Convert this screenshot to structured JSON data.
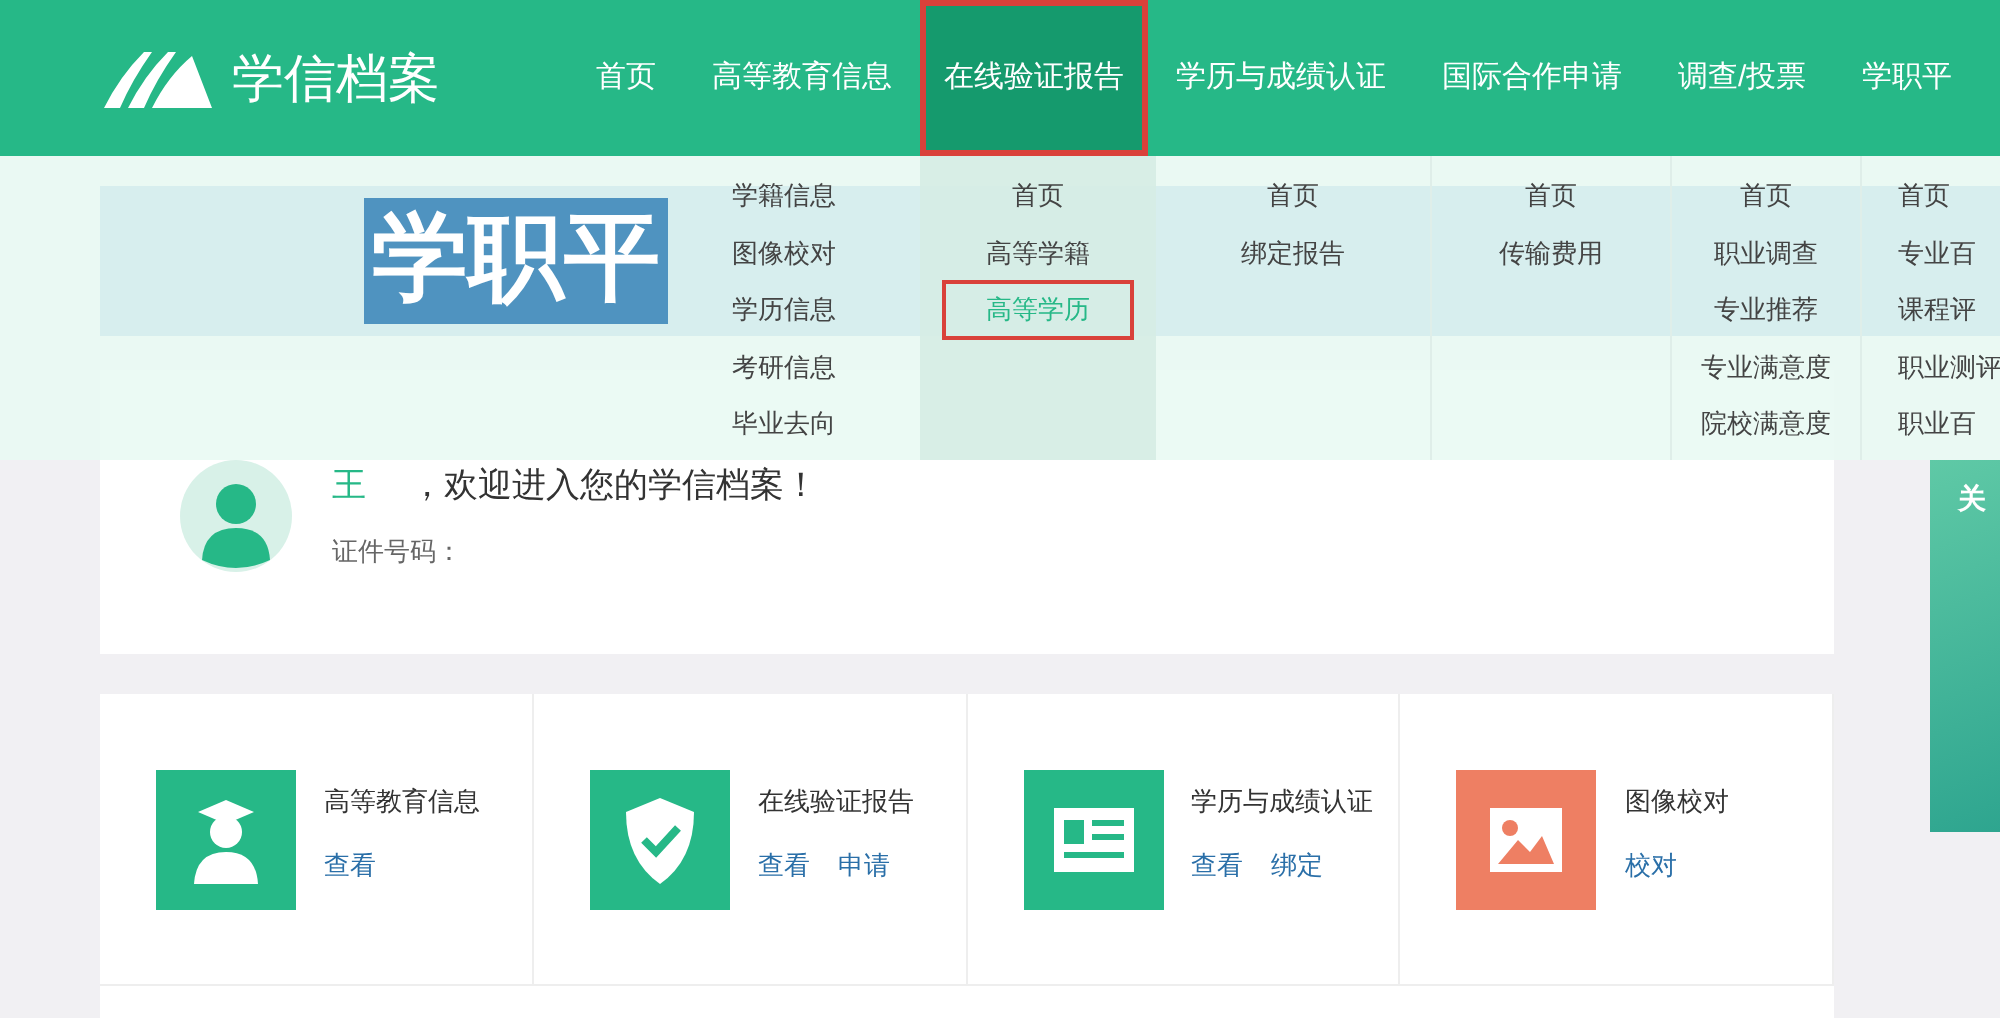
{
  "nav": {
    "logo": "学信档案",
    "items": [
      {
        "label": "首页",
        "selected": false,
        "marked": false
      },
      {
        "label": "高等教育信息",
        "selected": false,
        "marked": false,
        "submenu": [
          {
            "label": "学籍信息",
            "selected": false,
            "marked": false
          },
          {
            "label": "图像校对",
            "selected": false,
            "marked": false
          },
          {
            "label": "学历信息",
            "selected": false,
            "marked": false
          },
          {
            "label": "考研信息",
            "selected": false,
            "marked": false
          },
          {
            "label": "毕业去向",
            "selected": false,
            "marked": false
          }
        ]
      },
      {
        "label": "在线验证报告",
        "selected": true,
        "marked": true,
        "submenu": [
          {
            "label": "首页",
            "selected": false,
            "marked": false
          },
          {
            "label": "高等学籍",
            "selected": false,
            "marked": false
          },
          {
            "label": "高等学历",
            "selected": true,
            "marked": true
          }
        ]
      },
      {
        "label": "学历与成绩认证",
        "selected": false,
        "marked": false,
        "submenu": [
          {
            "label": "首页",
            "selected": false,
            "marked": false
          },
          {
            "label": "绑定报告",
            "selected": false,
            "marked": false
          }
        ]
      },
      {
        "label": "国际合作申请",
        "selected": false,
        "marked": false,
        "submenu": [
          {
            "label": "首页",
            "selected": false,
            "marked": false
          },
          {
            "label": "传输费用",
            "selected": false,
            "marked": false
          }
        ]
      },
      {
        "label": "调查/投票",
        "selected": false,
        "marked": false,
        "submenu": [
          {
            "label": "首页",
            "selected": false,
            "marked": false
          },
          {
            "label": "职业调查",
            "selected": false,
            "marked": false
          },
          {
            "label": "专业推荐",
            "selected": false,
            "marked": false
          },
          {
            "label": "专业满意度",
            "selected": false,
            "marked": false
          },
          {
            "label": "院校满意度",
            "selected": false,
            "marked": false
          }
        ]
      },
      {
        "label": "学职平",
        "selected": false,
        "marked": false,
        "submenu": [
          {
            "label": "首页",
            "selected": false,
            "marked": false
          },
          {
            "label": "专业百",
            "selected": false,
            "marked": false
          },
          {
            "label": "课程评",
            "selected": false,
            "marked": false
          },
          {
            "label": "职业测评",
            "selected": false,
            "marked": false
          },
          {
            "label": "职业百",
            "selected": false,
            "marked": false
          }
        ]
      }
    ]
  },
  "banner": {
    "text": "学职平"
  },
  "welcome": {
    "name": "王",
    "greeting": "，欢迎进入您的学信档案！",
    "id_label": "证件号码："
  },
  "side_ad": {
    "text": "关"
  },
  "services": [
    {
      "title": "高等教育信息",
      "kind": "graduate",
      "color": "#26b887",
      "links": [
        "查看"
      ]
    },
    {
      "title": "在线验证报告",
      "kind": "shield",
      "color": "#26b887",
      "links": [
        "查看",
        "申请"
      ]
    },
    {
      "title": "学历与成绩认证",
      "kind": "document",
      "color": "#26b887",
      "links": [
        "查看",
        "绑定"
      ]
    },
    {
      "title": "图像校对",
      "kind": "image",
      "color": "#ee7f63",
      "links": [
        "校对"
      ]
    }
  ]
}
